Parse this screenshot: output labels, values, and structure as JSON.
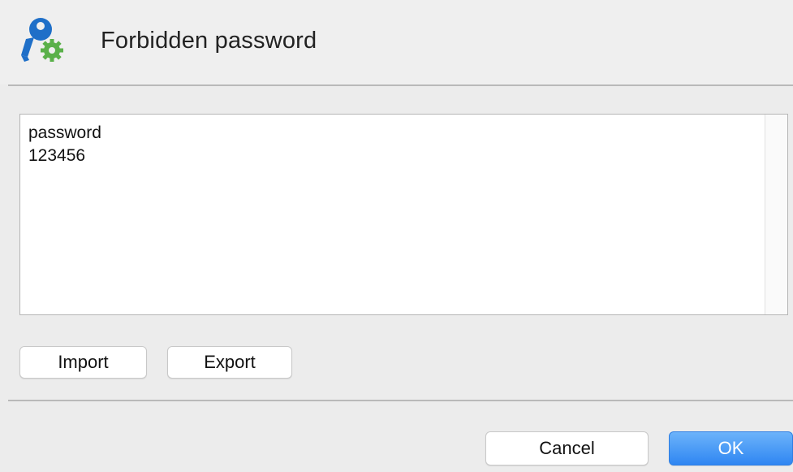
{
  "dialog": {
    "title": "Forbidden password",
    "icon": "key-gear-icon"
  },
  "password_list": {
    "items": [
      "password",
      "123456"
    ]
  },
  "buttons": {
    "import": "Import",
    "export": "Export",
    "cancel": "Cancel",
    "ok": "OK"
  },
  "colors": {
    "icon_blue": "#1f6fc8",
    "icon_green": "#5ab04a",
    "ok_button": "#2f86f2"
  }
}
